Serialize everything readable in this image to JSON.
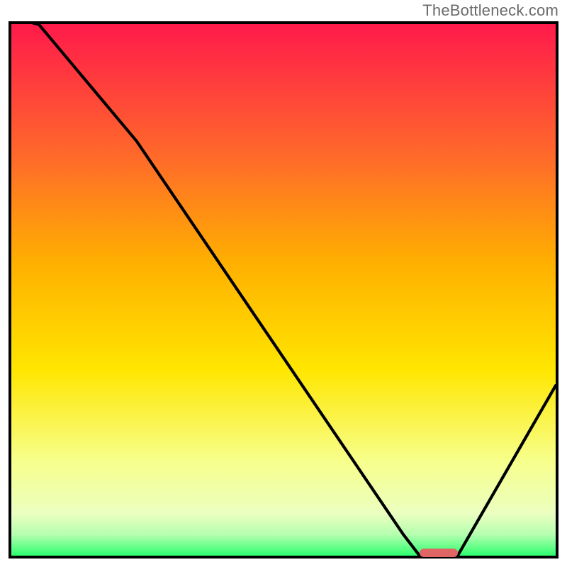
{
  "attribution": "TheBottleneck.com",
  "colors": {
    "top": "#ff1a4b",
    "mid_upper": "#ff9a1a",
    "mid": "#ffe600",
    "lower": "#f7ff8a",
    "bottom": "#2eff6e",
    "marker": "#e06666",
    "curve": "#000000",
    "border": "#000000"
  },
  "chart_data": {
    "type": "line",
    "title": "",
    "xlabel": "",
    "ylabel": "",
    "xlim": [
      0,
      100
    ],
    "ylim": [
      0,
      100
    ],
    "x": [
      0,
      5,
      23,
      72,
      75,
      82,
      100
    ],
    "values": [
      110,
      100,
      78,
      4,
      0,
      0,
      32
    ],
    "optimum_range_x": [
      75,
      82
    ],
    "marker_center_x": 77.5
  }
}
